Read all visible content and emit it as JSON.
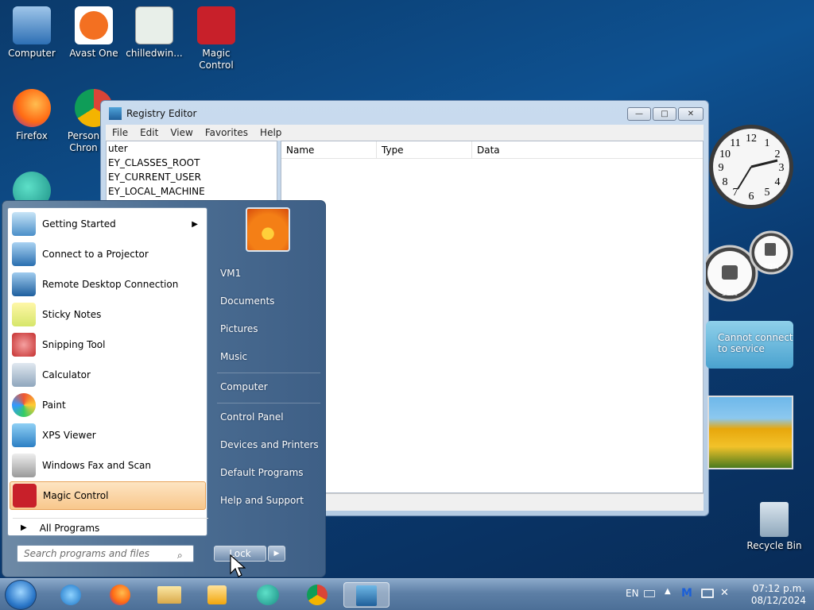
{
  "desktop_icons": [
    {
      "label": "Computer",
      "icon": "computer-icon"
    },
    {
      "label": "Avast One",
      "icon": "avast-icon"
    },
    {
      "label": "chilledwin...",
      "icon": "document-icon"
    },
    {
      "label": "Magic Control",
      "icon": "magic-control-icon"
    },
    {
      "label": "Firefox",
      "icon": "firefox-icon"
    },
    {
      "label": "Person Chron",
      "icon": "chrome-icon"
    },
    {
      "label": "Recycle Bin",
      "icon": "recycle-bin-icon"
    }
  ],
  "regedit": {
    "title": "Registry Editor",
    "menu": [
      "File",
      "Edit",
      "View",
      "Favorites",
      "Help"
    ],
    "tree": [
      "uter",
      "EY_CLASSES_ROOT",
      "EY_CURRENT_USER",
      "EY_LOCAL_MACHINE"
    ],
    "columns": [
      "Name",
      "Type",
      "Data"
    ],
    "buttons": {
      "minimize": "—",
      "maximize": "□",
      "close": "✕"
    }
  },
  "gadgets": {
    "clock_numbers": [
      "12",
      "1",
      "2",
      "3",
      "4",
      "5",
      "6",
      "7",
      "8",
      "9",
      "10",
      "11"
    ],
    "cpu_percent": "38%",
    "mem_percent": "40%",
    "weather_text": [
      "Cannot connect",
      "to service"
    ]
  },
  "start_menu": {
    "programs": [
      {
        "label": "Getting Started",
        "icon": "getting-started-icon",
        "has_submenu": true
      },
      {
        "label": "Connect to a Projector",
        "icon": "projector-icon"
      },
      {
        "label": "Remote Desktop Connection",
        "icon": "remote-desktop-icon"
      },
      {
        "label": "Sticky Notes",
        "icon": "sticky-notes-icon"
      },
      {
        "label": "Snipping Tool",
        "icon": "snipping-tool-icon"
      },
      {
        "label": "Calculator",
        "icon": "calculator-icon"
      },
      {
        "label": "Paint",
        "icon": "paint-icon"
      },
      {
        "label": "XPS Viewer",
        "icon": "xps-viewer-icon"
      },
      {
        "label": "Windows Fax and Scan",
        "icon": "fax-scan-icon"
      },
      {
        "label": "Magic Control",
        "icon": "magic-control-icon",
        "selected": true
      }
    ],
    "all_programs": "All Programs",
    "search_placeholder": "Search programs and files",
    "right_links": [
      "VM1",
      "Documents",
      "Pictures",
      "Music",
      "Computer",
      "Control Panel",
      "Devices and Printers",
      "Default Programs",
      "Help and Support"
    ],
    "lock_label": "Lock",
    "lock_arrow": "▶"
  },
  "taskbar": {
    "icons": [
      "start-orb-icon",
      "internet-explorer-icon",
      "firefox-icon",
      "explorer-icon",
      "media-player-icon",
      "teal-app-icon",
      "chrome-icon",
      "regedit-icon"
    ],
    "language": "EN",
    "time": "07:12 p.m.",
    "date": "08/12/2024"
  },
  "colors": {
    "desktop_bg": "#0e5292",
    "selected_item": "#f8c78c",
    "taskbar": "#5d7fa6"
  }
}
